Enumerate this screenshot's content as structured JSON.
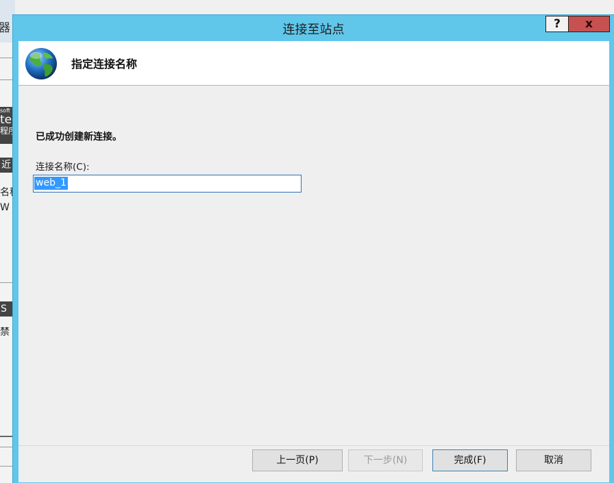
{
  "background_window": {
    "title_fragment": "器",
    "fragments": [
      "soft",
      "tе",
      "程序",
      "近",
      "名称",
      "W",
      "S",
      "禁"
    ]
  },
  "dialog": {
    "title": "连接至站点",
    "help_label": "?",
    "close_label": "x",
    "header_title": "指定连接名称",
    "header_icon": "globe-icon",
    "success_message": "已成功创建新连接。",
    "name_label": "连接名称(C):",
    "name_value": "web_1",
    "buttons": {
      "back": "上一页(P)",
      "next": "下一步(N)",
      "finish": "完成(F)",
      "cancel": "取消"
    }
  },
  "colors": {
    "titlebar": "#60c7eb",
    "close_button": "#c75050",
    "selection": "#3399ff"
  }
}
